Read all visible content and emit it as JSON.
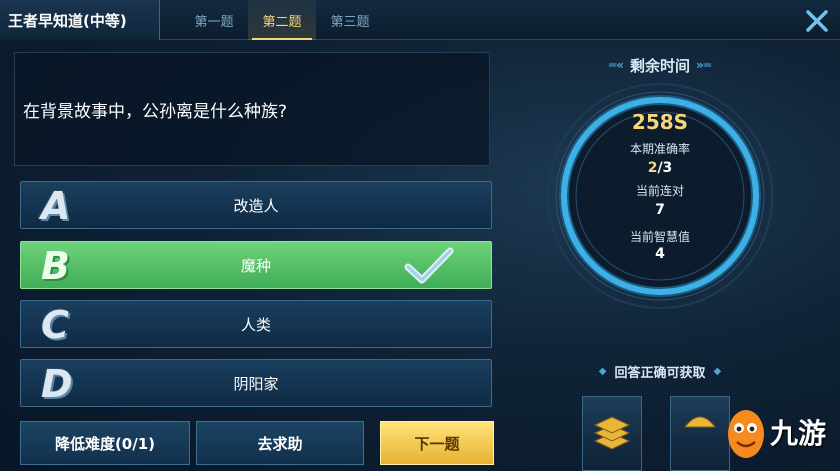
{
  "header": {
    "title": "王者早知道(中等)",
    "tabs": [
      {
        "label": "第一题",
        "active": false
      },
      {
        "label": "第二题",
        "active": true
      },
      {
        "label": "第三题",
        "active": false
      }
    ],
    "close_icon": "close-icon"
  },
  "question": {
    "text": "在背景故事中，公孙离是什么种族?"
  },
  "options": [
    {
      "letter": "A",
      "text": "改造人",
      "state": "normal"
    },
    {
      "letter": "B",
      "text": "魔种",
      "state": "correct"
    },
    {
      "letter": "C",
      "text": "人类",
      "state": "normal"
    },
    {
      "letter": "D",
      "text": "阴阳家",
      "state": "normal"
    }
  ],
  "buttons": {
    "lower_difficulty": "降低难度(0/1)",
    "ask_help": "去求助",
    "next": "下一题"
  },
  "timer": {
    "label": "剩余时间",
    "remaining_value": "258S",
    "remaining_seconds": 258
  },
  "stats": {
    "accuracy_label": "本期准确率",
    "accuracy_hit": "2",
    "accuracy_total": "/3",
    "streak_label": "当前连对",
    "streak_value": "7",
    "wisdom_label": "当前智慧值",
    "wisdom_value": "4"
  },
  "rewards": {
    "label": "回答正确可获取",
    "items": [
      "coin-stack-icon",
      "gold-icon"
    ]
  },
  "watermark": {
    "text": "九游"
  },
  "colors": {
    "accent_blue": "#3fa9e0",
    "accent_gold": "#f6d67a",
    "correct_green": "#4fbf62",
    "next_button": "#f3c64a"
  }
}
